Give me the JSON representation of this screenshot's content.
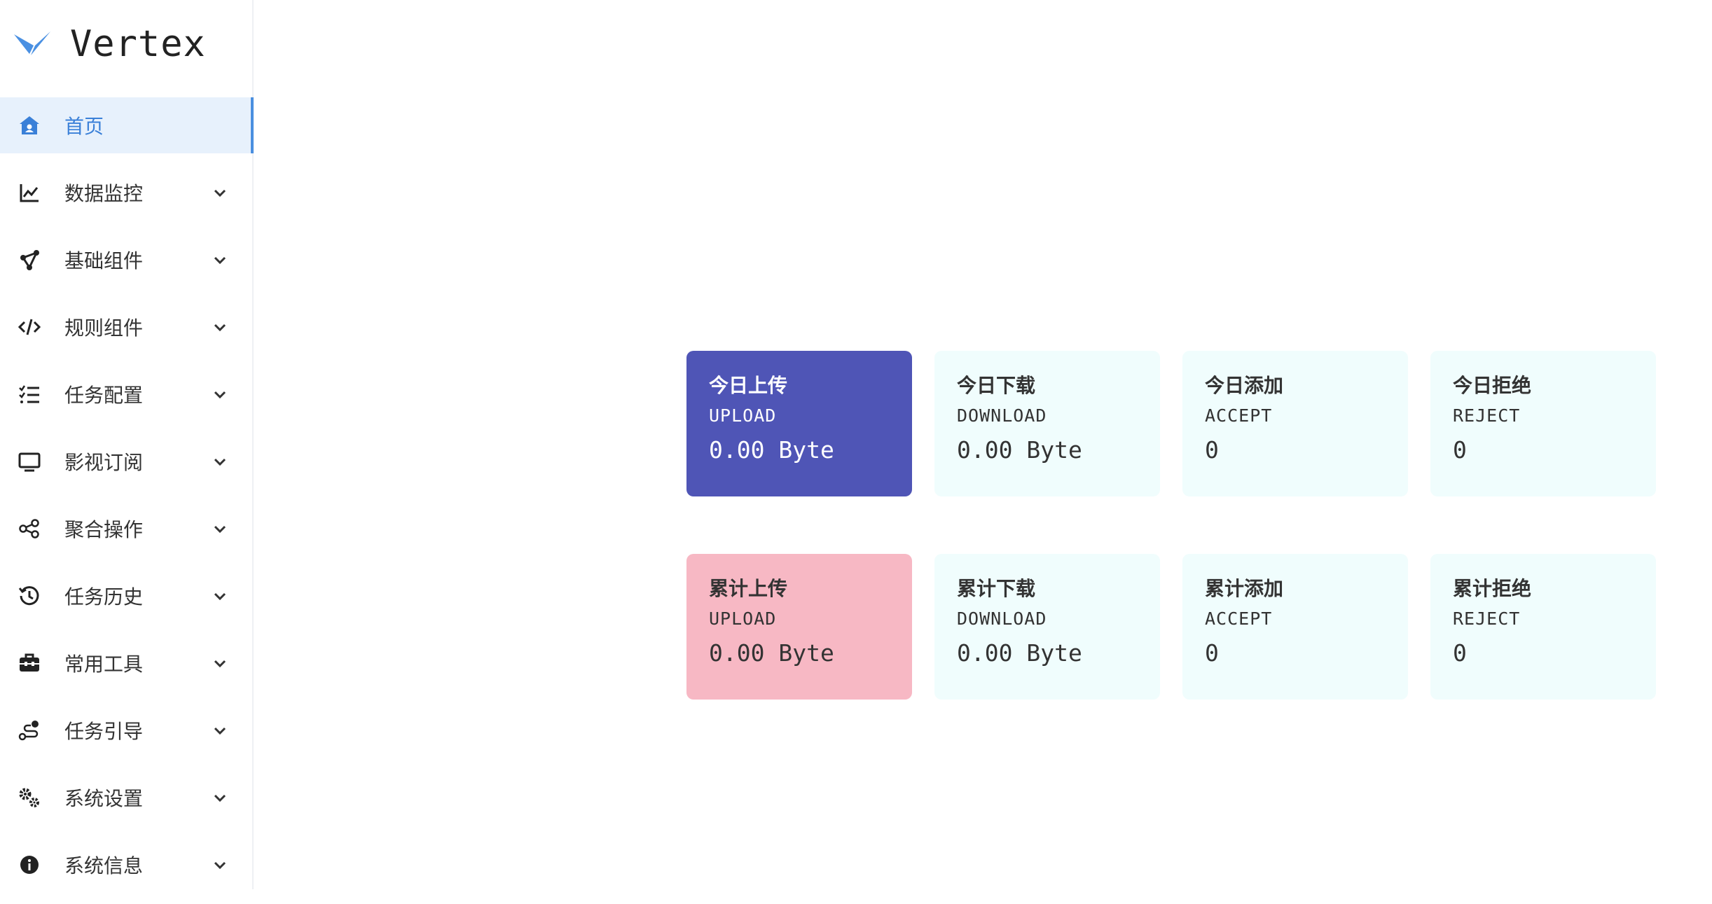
{
  "app": {
    "name": "Vertex"
  },
  "colors": {
    "accent": "#4a8fe0",
    "upload_today": "#4f55b6",
    "upload_total": "#f7b8c4",
    "card_bg": "#f0fdfd"
  },
  "sidebar": {
    "items": [
      {
        "label": "首页",
        "icon": "home-icon",
        "active": true
      },
      {
        "label": "数据监控",
        "icon": "chart-line-icon"
      },
      {
        "label": "基础组件",
        "icon": "nodes-icon"
      },
      {
        "label": "规则组件",
        "icon": "code-icon"
      },
      {
        "label": "任务配置",
        "icon": "checklist-icon"
      },
      {
        "label": "影视订阅",
        "icon": "monitor-icon"
      },
      {
        "label": "聚合操作",
        "icon": "share-icon"
      },
      {
        "label": "任务历史",
        "icon": "history-icon"
      },
      {
        "label": "常用工具",
        "icon": "toolbox-icon"
      },
      {
        "label": "任务引导",
        "icon": "route-icon"
      },
      {
        "label": "系统设置",
        "icon": "gears-icon"
      },
      {
        "label": "系统信息",
        "icon": "info-icon"
      }
    ]
  },
  "stats": {
    "today": [
      {
        "title": "今日上传",
        "sub": "UPLOAD",
        "value": "0.00 Byte"
      },
      {
        "title": "今日下载",
        "sub": "DOWNLOAD",
        "value": "0.00 Byte"
      },
      {
        "title": "今日添加",
        "sub": "ACCEPT",
        "value": "0"
      },
      {
        "title": "今日拒绝",
        "sub": "REJECT",
        "value": "0"
      }
    ],
    "total": [
      {
        "title": "累计上传",
        "sub": "UPLOAD",
        "value": "0.00 Byte"
      },
      {
        "title": "累计下载",
        "sub": "DOWNLOAD",
        "value": "0.00 Byte"
      },
      {
        "title": "累计添加",
        "sub": "ACCEPT",
        "value": "0"
      },
      {
        "title": "累计拒绝",
        "sub": "REJECT",
        "value": "0"
      }
    ]
  }
}
